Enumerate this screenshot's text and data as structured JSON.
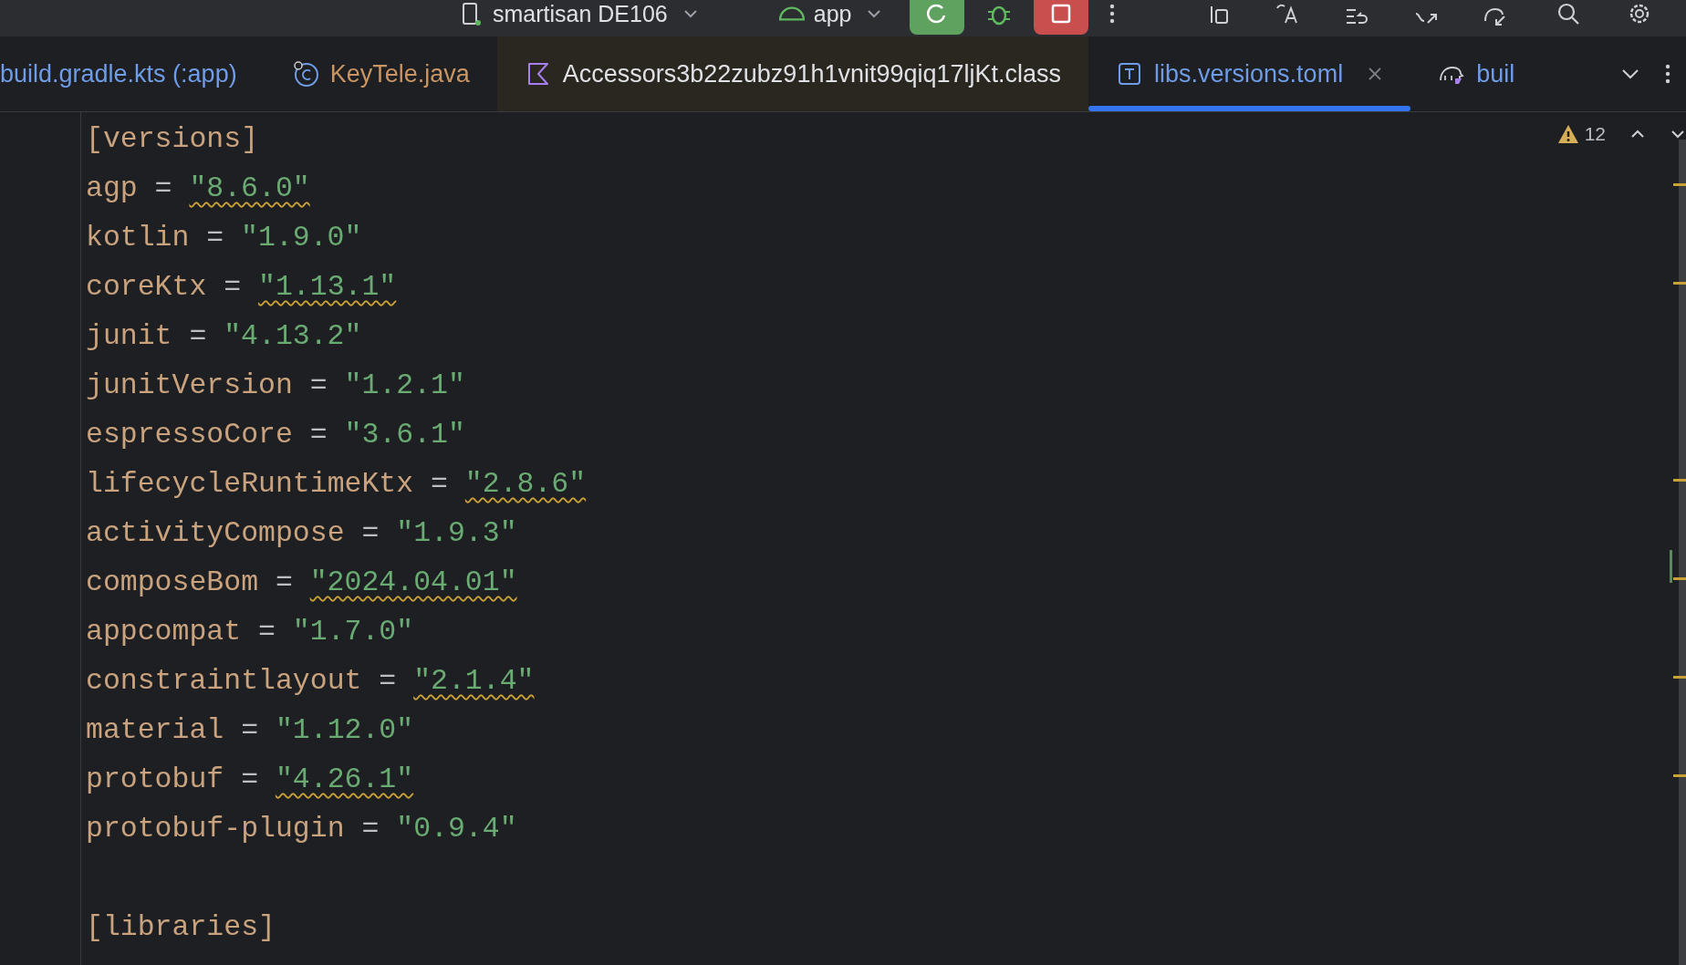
{
  "toolbar": {
    "device": "smartisan DE106",
    "config": "app"
  },
  "tabs": [
    {
      "label": "build.gradle.kts (:app)",
      "kind": "plain",
      "color": "#6f9ce6",
      "selected": false,
      "shaded": false
    },
    {
      "label": "KeyTele.java",
      "kind": "java",
      "color": "#c99563",
      "selected": false,
      "shaded": false
    },
    {
      "label": "Accessors3b22zubz91h1vnit99qiq17ljKt.class",
      "kind": "kotlin",
      "color": "#dfe1e5",
      "selected": false,
      "shaded": true
    },
    {
      "label": "libs.versions.toml",
      "kind": "toml",
      "color": "#6f9ce6",
      "selected": true,
      "shaded": false
    },
    {
      "label": "buil",
      "kind": "gradle",
      "color": "#6f9ce6",
      "selected": false,
      "shaded": false
    }
  ],
  "inspections": {
    "warnings": "12"
  },
  "lines": [
    {
      "kind": "section",
      "text": "[versions]"
    },
    {
      "kind": "entry",
      "key": "agp",
      "op": "=",
      "value": "\"8.6.0\"",
      "outdated": true
    },
    {
      "kind": "entry",
      "key": "kotlin",
      "op": "=",
      "value": "\"1.9.0\"",
      "outdated": false
    },
    {
      "kind": "entry",
      "key": "coreKtx",
      "op": "=",
      "value": "\"1.13.1\"",
      "outdated": true
    },
    {
      "kind": "entry",
      "key": "junit",
      "op": "=",
      "value": "\"4.13.2\"",
      "outdated": false
    },
    {
      "kind": "entry",
      "key": "junitVersion",
      "op": "=",
      "value": "\"1.2.1\"",
      "outdated": false
    },
    {
      "kind": "entry",
      "key": "espressoCore",
      "op": "=",
      "value": "\"3.6.1\"",
      "outdated": false
    },
    {
      "kind": "entry",
      "key": "lifecycleRuntimeKtx",
      "op": "=",
      "value": "\"2.8.6\"",
      "outdated": true
    },
    {
      "kind": "entry",
      "key": "activityCompose",
      "op": "=",
      "value": "\"1.9.3\"",
      "outdated": false
    },
    {
      "kind": "entry",
      "key": "composeBom",
      "op": "=",
      "value": "\"2024.04.01\"",
      "outdated": true
    },
    {
      "kind": "entry",
      "key": "appcompat",
      "op": "=",
      "value": "\"1.7.0\"",
      "outdated": false
    },
    {
      "kind": "entry",
      "key": "constraintlayout",
      "op": "=",
      "value": "\"2.1.4\"",
      "outdated": true
    },
    {
      "kind": "entry",
      "key": "material",
      "op": "=",
      "value": "\"1.12.0\"",
      "outdated": false
    },
    {
      "kind": "entry",
      "key": "protobuf",
      "op": "=",
      "value": "\"4.26.1\"",
      "outdated": true
    },
    {
      "kind": "entry",
      "key": "protobuf-plugin",
      "op": "=",
      "value": "\"0.9.4\"",
      "outdated": false
    },
    {
      "kind": "blank"
    },
    {
      "kind": "section",
      "text": "[libraries]"
    }
  ]
}
